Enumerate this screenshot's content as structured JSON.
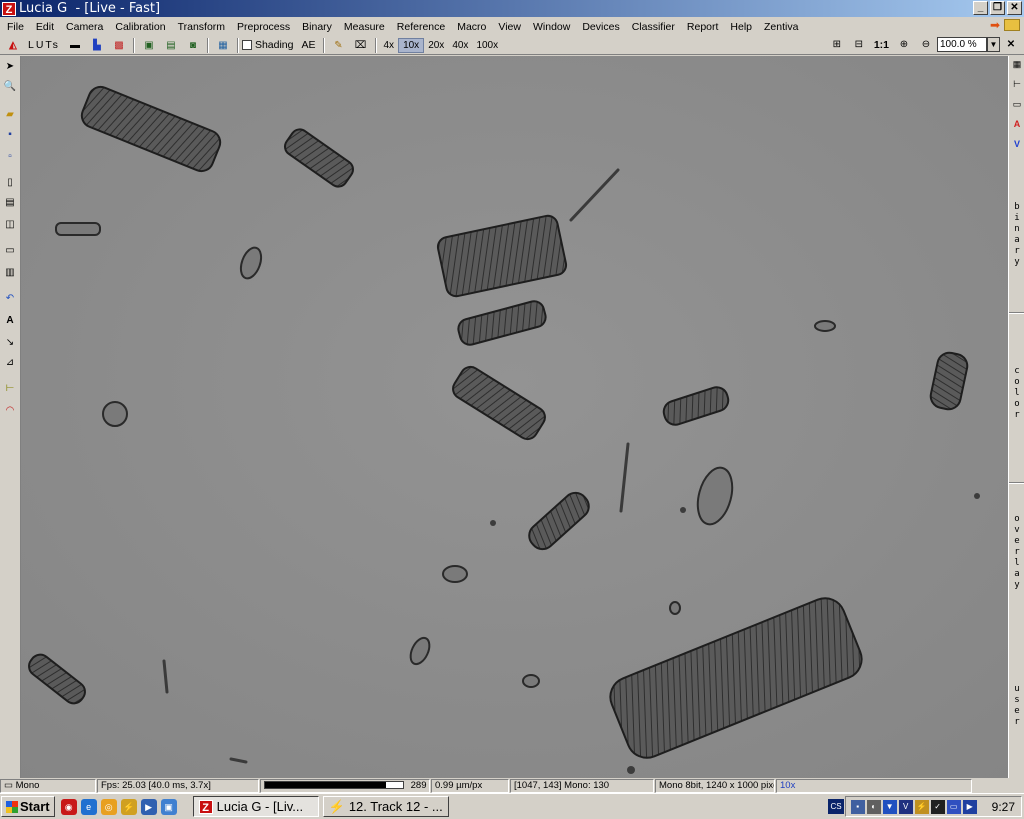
{
  "window": {
    "title": "Lucia G  - [Live - Fast]",
    "logo": "Z",
    "minimize": "_",
    "restore": "❐",
    "close": "✕"
  },
  "menu": [
    "File",
    "Edit",
    "Camera",
    "Calibration",
    "Transform",
    "Preprocess",
    "Binary",
    "Measure",
    "Reference",
    "Macro",
    "View",
    "Window",
    "Devices",
    "Classifier",
    "Report",
    "Help",
    "Zentiva"
  ],
  "toolbar": {
    "luts_label": "LUTs",
    "shading_label": "Shading",
    "shading_checked": false,
    "ae_label": "AE",
    "magnifications": [
      "4x",
      "10x",
      "20x",
      "40x",
      "100x"
    ],
    "active_magnification": "10x",
    "one_to_one": "1:1",
    "zoom_value": "100.0 %",
    "close": "✕"
  },
  "right_panel": {
    "labels": [
      "binary",
      "color",
      "overlay",
      "user"
    ],
    "icon_a": "A",
    "icon_v": "V"
  },
  "statusbar": {
    "mode": "Mono",
    "fps": "Fps: 25.03 [40.0 ms, 3.7x]",
    "progress_fraction": 0.88,
    "progress_value": "289",
    "scale": "0.99 µm/px",
    "cursor": "[1047, 143] Mono: 130",
    "image_info": "Mono 8bit, 1240 x 1000 pixels",
    "objective": "10x"
  },
  "taskbar": {
    "start_label": "Start",
    "tasks": [
      {
        "label": "Lucia G  - [Liv...",
        "active": true
      },
      {
        "label": "12. Track 12 - ...",
        "active": false
      }
    ],
    "lang": "CS",
    "clock": "9:27"
  },
  "colors": {
    "titlebar_start": "#0a246a",
    "titlebar_end": "#a6caf0",
    "viewport_bg": "#8c8c8c",
    "active_mag_bg": "#a9b4cc",
    "right_panel_accent_a": "#d02020",
    "right_panel_accent_v": "#2040d0"
  }
}
